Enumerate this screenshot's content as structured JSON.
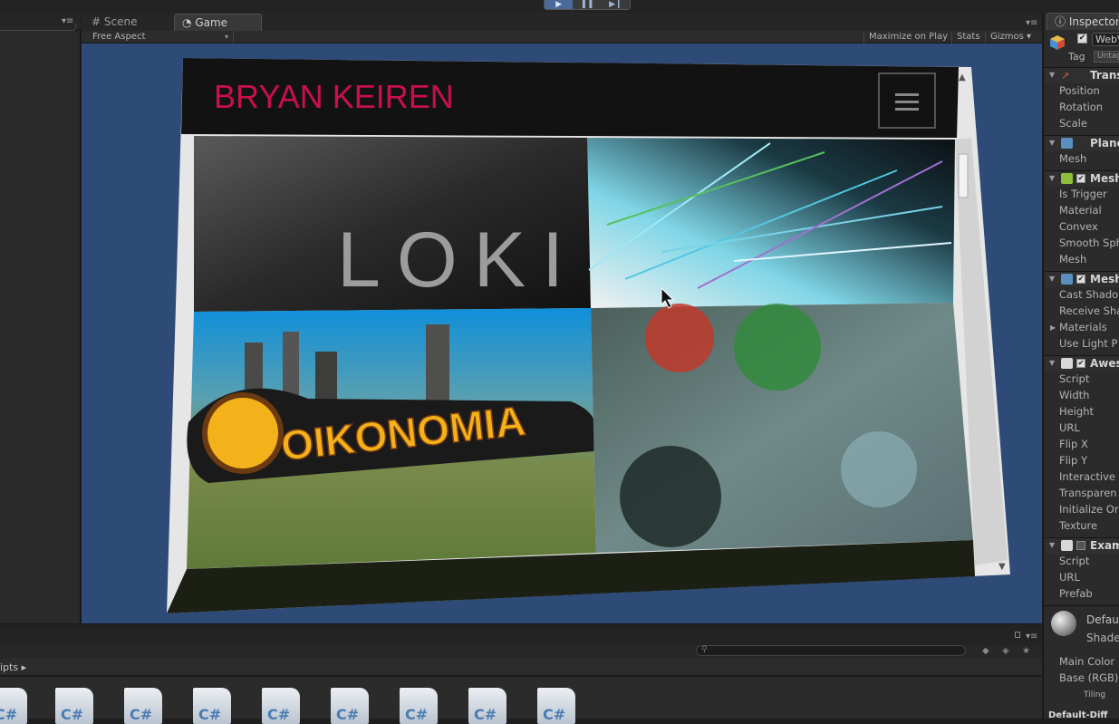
{
  "toolbar": {
    "play": "▶",
    "pause": "❚❚",
    "step": "▶❙"
  },
  "tabs": {
    "scene": "Scene",
    "game": "Game"
  },
  "game_bar": {
    "aspect": "Free Aspect",
    "maximize_on_play": "Maximize on Play",
    "stats": "Stats",
    "gizmos": "Gizmos"
  },
  "web_page": {
    "site_title": "BRYAN KEIREN",
    "tiles": [
      "LOKI",
      "OIKONOMIA"
    ],
    "accent_color": "#c8104a"
  },
  "inspector": {
    "tab": "Inspector",
    "object_name": "WebV",
    "tag_label": "Tag",
    "tag_value": "Untag",
    "sections": [
      {
        "title": "Trans",
        "props": [
          "Position",
          "Rotation",
          "Scale"
        ]
      },
      {
        "title": "Plane",
        "props": [
          "Mesh"
        ]
      },
      {
        "title": "Mesh",
        "props": [
          "Is Trigger",
          "Material",
          "Convex",
          "Smooth Sph",
          "Mesh"
        ]
      },
      {
        "title": "Mesh",
        "props": [
          "Cast Shado",
          "Receive Sha",
          "Materials",
          "Use Light P"
        ]
      },
      {
        "title": "Awes",
        "props": [
          "Script",
          "Width",
          "Height",
          "URL",
          "Flip X",
          "Flip Y",
          "Interactive",
          "Transparen",
          "Initialize Or",
          "Texture"
        ]
      },
      {
        "title": "Exam",
        "props": [
          "Script",
          "URL",
          "Prefab"
        ]
      }
    ],
    "material": {
      "name": "Defau",
      "shader": "Shade",
      "main_color": "Main Color",
      "base_rgb": "Base (RGB)",
      "tiling": "Tiling",
      "footer": "Default-Diff"
    }
  },
  "project": {
    "breadcrumb": "ipts ▸",
    "file_glyph": "C#",
    "file_count": 9
  }
}
